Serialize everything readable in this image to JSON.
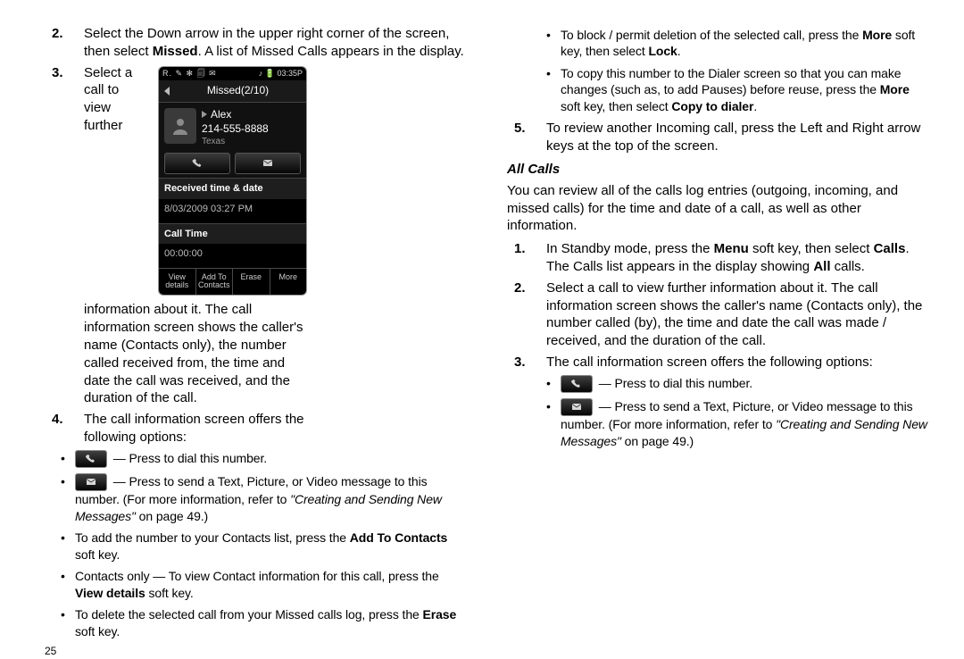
{
  "pageNumber": "25",
  "left": {
    "step2_num": "2.",
    "step2_a": "Select the Down arrow in the upper right corner of the screen, then select ",
    "step2_b": "Missed",
    "step2_c": ". A list of Missed Calls appears in the display.",
    "step3_num": "3.",
    "step3": "Select a call to view further information about it. The call information screen shows the caller's name (Contacts only), the number called received from, the time and date the call was received, and the duration of the call.",
    "step4_num": "4.",
    "step4": "The call information screen offers the following options:",
    "b1": " — Press to dial this number.",
    "b2_a": " — Press to send a Text, Picture, or Video message to this number. (For more information, refer to ",
    "b2_em": "\"Creating and Sending New Messages\"",
    "b2_b": "  on page 49.)",
    "b3_a": "To add the number to your Contacts list, press the ",
    "b3_b": "Add To Contacts",
    "b3_c": " soft key.",
    "b4_a": "Contacts only — To view Contact information for this call, press the ",
    "b4_b": "View details",
    "b4_c": " soft key.",
    "b5_a": "To delete the selected call from your Missed calls log, press the ",
    "b5_b": "Erase",
    "b5_c": " soft key."
  },
  "right": {
    "b1_a": "To block / permit deletion of the selected call, press the ",
    "b1_b": "More",
    "b1_c": " soft key, then select ",
    "b1_d": "Lock",
    "b1_e": ".",
    "b2_a": "To copy this number to the Dialer screen so that you can make changes (such as, to add Pauses) before reuse, press the ",
    "b2_b": "More",
    "b2_c": " soft key, then select ",
    "b2_d": "Copy to dialer",
    "b2_e": ".",
    "step5_num": "5.",
    "step5": "To review another Incoming call, press the Left and Right arrow keys at the top of the screen.",
    "sec_title": "All Calls",
    "intro": "You can review all of the calls log entries (outgoing, incoming, and missed calls) for the time and date of a call, as well as other information.",
    "s1_num": "1.",
    "s1_a": "In Standby mode, press the ",
    "s1_b": "Menu",
    "s1_c": " soft key, then select ",
    "s1_d": "Calls",
    "s1_e": ". The Calls list appears in the display showing ",
    "s1_f": "All",
    "s1_g": " calls.",
    "s2_num": "2.",
    "s2": "Select a call to view further information about it. The call information screen shows the caller's name (Contacts only), the number called (by), the time and date the call was made / received, and the duration of the call.",
    "s3_num": "3.",
    "s3": "The call information screen offers the following options:",
    "rb1": " — Press to dial this number.",
    "rb2_a": " — Press to send a Text, Picture, or Video message to this number. (For more information, refer to ",
    "rb2_em": "\"Creating and Sending New Messages\"",
    "rb2_b": "  on page 49.)"
  },
  "phone": {
    "statusLeft": "R.",
    "statusTime": "03:35P",
    "title": "Missed(2/10)",
    "name": "Alex",
    "number": "214-555-8888",
    "region": "Texas",
    "rt_hdr": "Received time & date",
    "rt_val": "8/03/2009 03:27 PM",
    "ct_hdr": "Call Time",
    "ct_val": "00:00:00",
    "sk1": "View details",
    "sk2": "Add To Contacts",
    "sk3": "Erase",
    "sk4": "More"
  }
}
